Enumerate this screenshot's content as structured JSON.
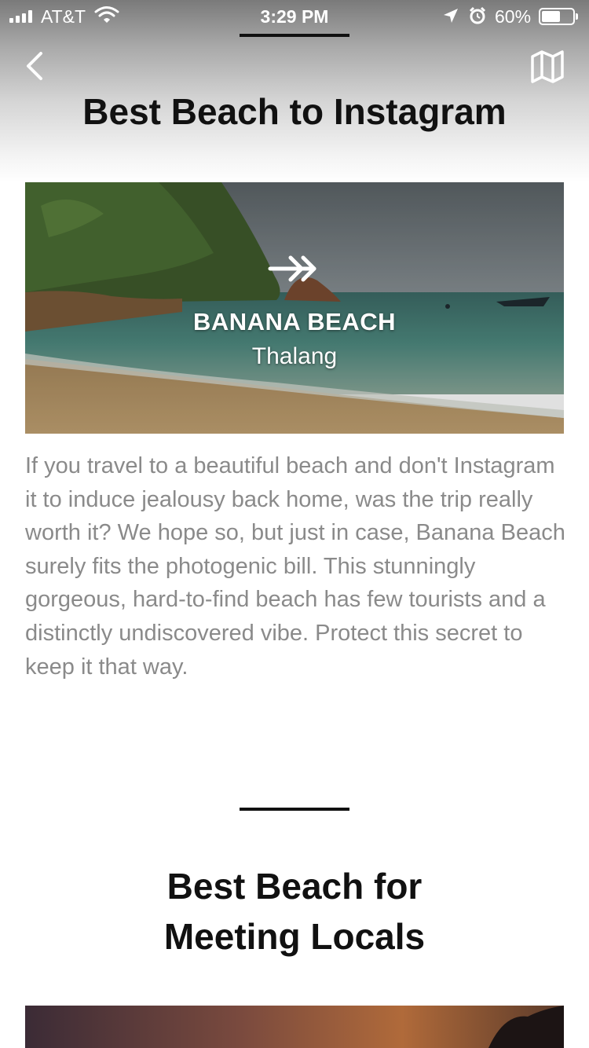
{
  "status_bar": {
    "carrier": "AT&T",
    "time": "3:29 PM",
    "battery_percent": "60%",
    "battery_level": 0.6
  },
  "header": {
    "back_icon": "chevron-left-icon",
    "map_icon": "map-icon"
  },
  "sections": [
    {
      "title": "Best Beach to Instagram",
      "card": {
        "name": "BANANA BEACH",
        "location": "Thalang",
        "arrow_icon": "double-arrow-right-icon"
      },
      "description": "If you travel to a beautiful beach and don't Instagram it to induce jealousy back home, was the trip really worth it? We hope so, but just in case, Banana Beach surely fits the photogenic bill. This stunningly gorgeous, hard-to-find beach has few tourists and a distinctly undiscovered vibe. Protect this secret to keep it that way."
    },
    {
      "title_lines": [
        "Best Beach for",
        "Meeting Locals"
      ]
    }
  ]
}
